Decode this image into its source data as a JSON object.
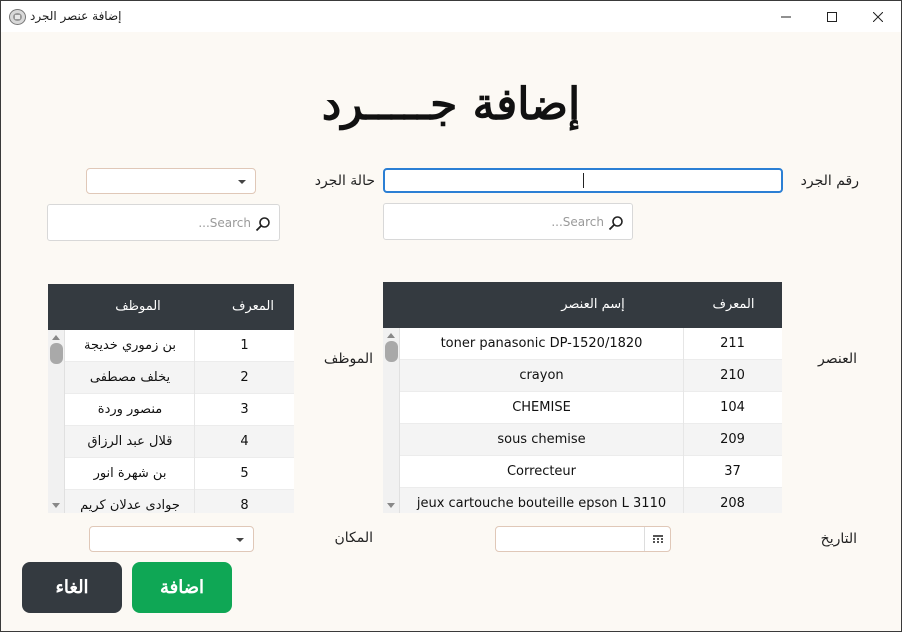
{
  "window": {
    "title": "إضافة عنصر الجرد"
  },
  "form": {
    "heading": "إضافة جـــــرد",
    "labels": {
      "inventory_number": "رقم الجرد",
      "inventory_status": "حالة الجرد",
      "item": "العنصر",
      "employee": "الموظف",
      "date": "التاريخ",
      "place": "المكان"
    },
    "inventory_number_value": "",
    "status_selected": "",
    "place_selected": "",
    "date_value": ""
  },
  "item_search": {
    "placeholder": "...Search"
  },
  "employee_search": {
    "placeholder": "...Search"
  },
  "items_table": {
    "columns": {
      "id": "المعرف",
      "name": "إسم العنصر"
    },
    "rows": [
      {
        "id": "211",
        "name": "toner panasonic DP-1520/1820"
      },
      {
        "id": "210",
        "name": "crayon"
      },
      {
        "id": "104",
        "name": "CHEMISE"
      },
      {
        "id": "209",
        "name": "sous chemise"
      },
      {
        "id": "37",
        "name": "Correcteur"
      },
      {
        "id": "208",
        "name": "jeux cartouche bouteille epson L 3110"
      }
    ]
  },
  "employees_table": {
    "columns": {
      "id": "المعرف",
      "name": "الموظف"
    },
    "rows": [
      {
        "id": "1",
        "name": "بن زموري خديجة"
      },
      {
        "id": "2",
        "name": "يخلف مصطفى"
      },
      {
        "id": "3",
        "name": "منصور وردة"
      },
      {
        "id": "4",
        "name": "قلال عبد الرزاق"
      },
      {
        "id": "5",
        "name": "بن شهرة  انور"
      },
      {
        "id": "8",
        "name": "جوادى عدلان كريم"
      }
    ]
  },
  "buttons": {
    "add": "اضافة",
    "cancel": "الغاء"
  },
  "colors": {
    "add_button": "#0fa755",
    "cancel_button": "#343a40",
    "table_header": "#343a40",
    "focus_border": "#2b7fd4"
  }
}
